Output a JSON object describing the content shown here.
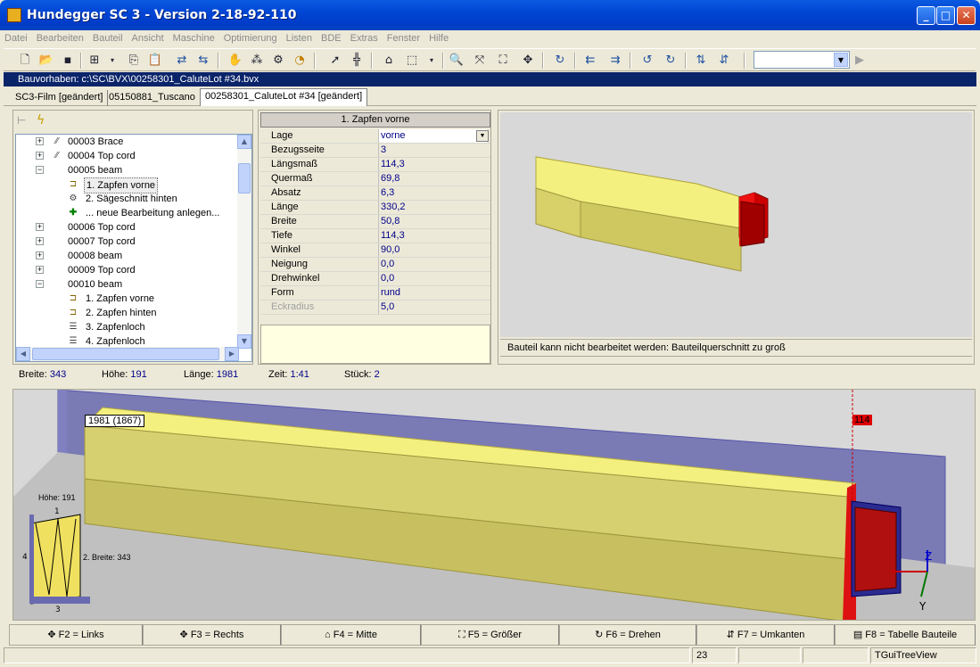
{
  "window": {
    "title": "Hundegger SC 3 - Version 2-18-92-110"
  },
  "menu": [
    "Datei",
    "Bearbeiten",
    "Bauteil",
    "Ansicht",
    "Maschine",
    "Optimierung",
    "Listen",
    "BDE",
    "Extras",
    "Fenster",
    "Hilfe"
  ],
  "path": "Bauvorhaben: c:\\SC\\BVX\\00258301_CaluteLot #34.bvx",
  "tabs": [
    "SC3-Film [geändert]",
    "05150881_Tuscano",
    "00258301_CaluteLot #34 [geändert]"
  ],
  "tree": [
    {
      "id": "00003",
      "label": "Brace",
      "expanded": false
    },
    {
      "id": "00004",
      "label": "Top cord",
      "expanded": false
    },
    {
      "id": "00005",
      "label": "beam",
      "expanded": true
    },
    {
      "child": "1. Zapfen vorne",
      "selected": true
    },
    {
      "child": "2. Sägeschnitt hinten"
    },
    {
      "child": "... neue Bearbeitung anlegen..."
    },
    {
      "id": "00006",
      "label": "Top cord",
      "expanded": false
    },
    {
      "id": "00007",
      "label": "Top cord",
      "expanded": false
    },
    {
      "id": "00008",
      "label": "beam",
      "expanded": false
    },
    {
      "id": "00009",
      "label": "Top cord",
      "expanded": false
    },
    {
      "id": "00010",
      "label": "beam",
      "expanded": true
    },
    {
      "child": "1. Zapfen vorne"
    },
    {
      "child": "2. Zapfen hinten"
    },
    {
      "child": "3. Zapfenloch"
    },
    {
      "child": "4. Zapfenloch"
    }
  ],
  "props": {
    "header": "1. Zapfen vorne",
    "rows": [
      {
        "k": "Lage",
        "v": "vorne"
      },
      {
        "k": "Bezugsseite",
        "v": "3"
      },
      {
        "k": "Längsmaß",
        "v": "114,3"
      },
      {
        "k": "Quermaß",
        "v": "69,8"
      },
      {
        "k": "Absatz",
        "v": "6,3"
      },
      {
        "k": "Länge",
        "v": "330,2"
      },
      {
        "k": "Breite",
        "v": "50,8"
      },
      {
        "k": "Tiefe",
        "v": "114,3"
      },
      {
        "k": "Winkel",
        "v": "90,0"
      },
      {
        "k": "Neigung",
        "v": "0,0"
      },
      {
        "k": "Drehwinkel",
        "v": "0,0"
      },
      {
        "k": "Form",
        "v": "rund"
      },
      {
        "k": "Eckradius",
        "v": "5,0"
      }
    ]
  },
  "preview_msg": "Bauteil kann nicht bearbeitet werden: Bauteilquerschnitt zu groß",
  "info": {
    "breite_l": "Breite:",
    "breite": "343",
    "hoehe_l": "Höhe:",
    "hoehe": "191",
    "laenge_l": "Länge:",
    "laenge": "1981",
    "zeit_l": "Zeit:",
    "zeit": "1:41",
    "stueck_l": "Stück:",
    "stueck": "2"
  },
  "view": {
    "dim_label": "1981 (1867)",
    "red_tag": "114",
    "hoehe_lbl": "Höhe:  191",
    "breite_lbl": "2. Breite:  343",
    "side1": "1",
    "side3": "3",
    "side4": "4",
    "axis_z": "Z",
    "axis_y": "Y"
  },
  "fkeys": [
    "F2 = Links",
    "F3 = Rechts",
    "F4 = Mitte",
    "F5 = Größer",
    "F6 = Drehen",
    "F7 = Umkanten",
    "F8 = Tabelle Bauteile"
  ],
  "status": {
    "num": "23",
    "class": "TGuiTreeView"
  },
  "colors": {
    "beam": "#f0f080",
    "beam_shade": "#c8c060",
    "tenon": "#cc0000",
    "plane": "#6666aa"
  }
}
